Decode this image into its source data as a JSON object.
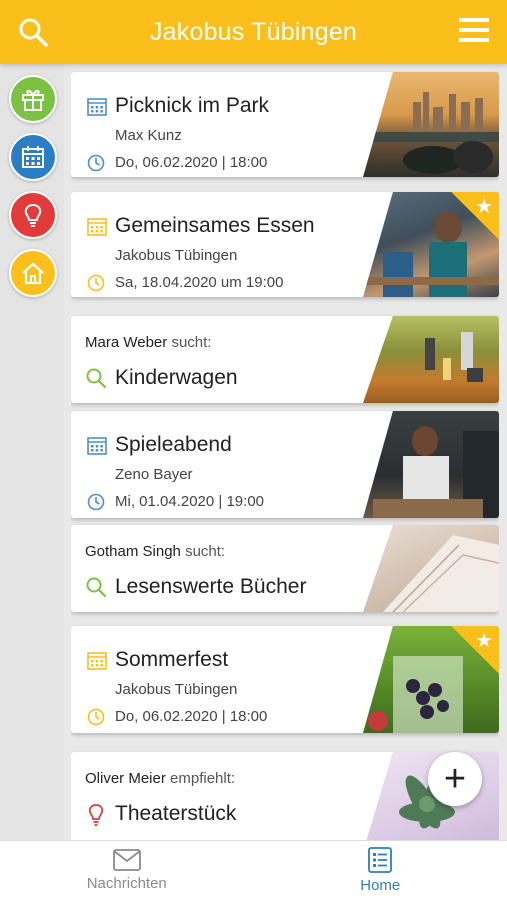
{
  "header": {
    "title": "Jakobus Tübingen"
  },
  "cards": [
    {
      "title": "Picknick im Park",
      "organizer": "Max Kunz",
      "datetime": "Do, 06.02.2020 | 18:00"
    },
    {
      "title": "Gemeinsames Essen",
      "organizer": "Jakobus Tübingen",
      "datetime": "Sa, 18.04.2020 um 19:00"
    },
    {
      "person": "Mara Weber",
      "verb": "sucht:",
      "title": "Kinderwagen"
    },
    {
      "title": "Spieleabend",
      "organizer": "Zeno Bayer",
      "datetime": "Mi, 01.04.2020 | 19:00"
    },
    {
      "person": "Gotham Singh",
      "verb": "sucht:",
      "title": "Lesenswerte Bücher"
    },
    {
      "title": "Sommerfest",
      "organizer": "Jakobus Tübingen",
      "datetime": "Do, 06.02.2020 | 18:00"
    },
    {
      "person": "Oliver Meier",
      "verb": "empfiehlt:",
      "title": "Theaterstück"
    }
  ],
  "fab": {
    "label": "+"
  },
  "bottom_nav": {
    "messages": "Nachrichten",
    "home": "Home"
  },
  "colors": {
    "accent": "#fbbf1b",
    "blue": "#2c7ec4",
    "green": "#7cc242",
    "red": "#e23b3b"
  }
}
